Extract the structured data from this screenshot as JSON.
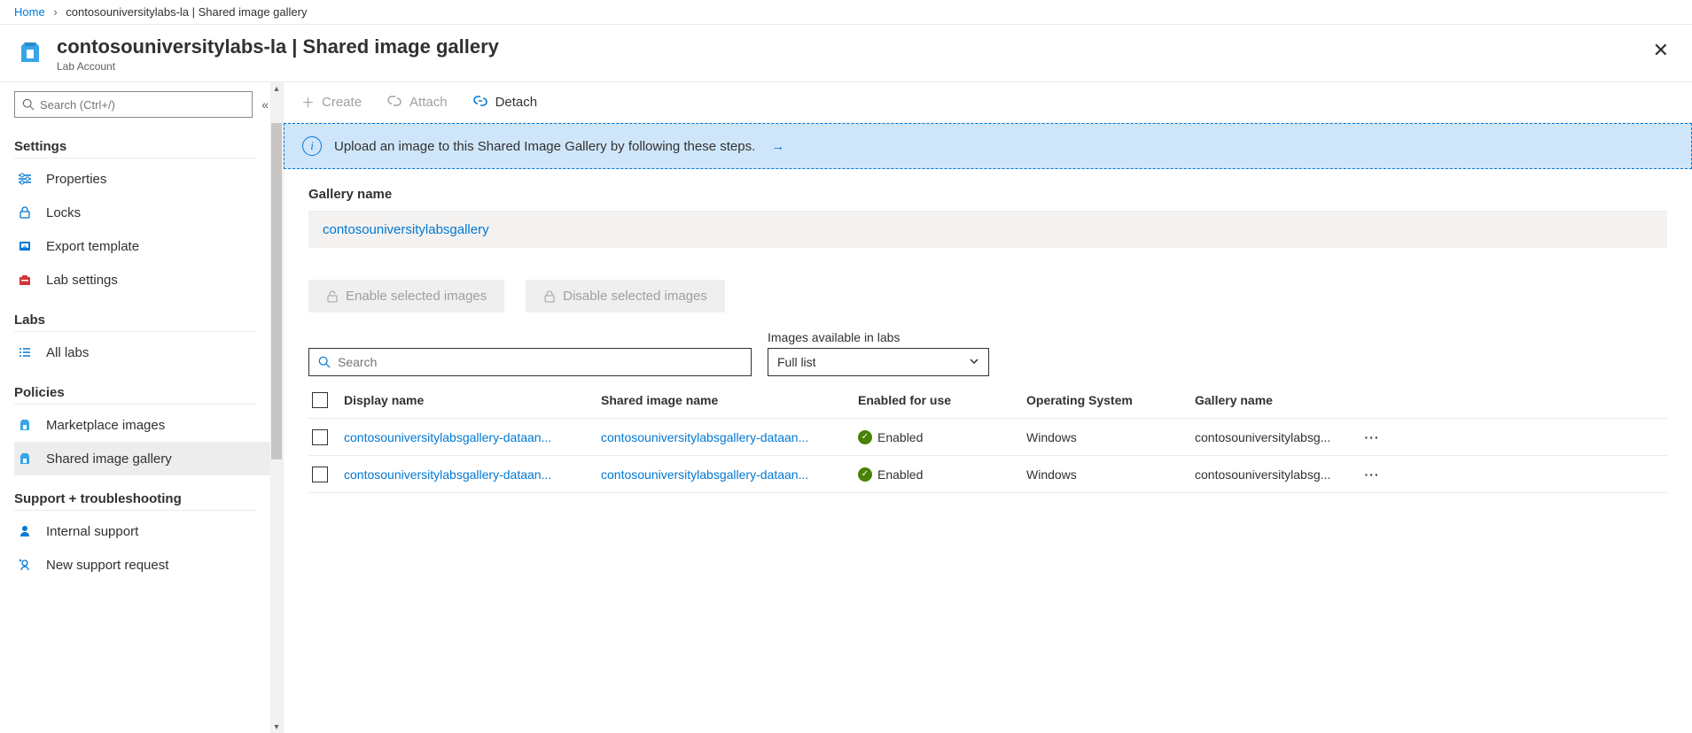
{
  "breadcrumb": {
    "home": "Home",
    "current": "contosouniversitylabs-la | Shared image gallery"
  },
  "header": {
    "title": "contosouniversitylabs-la | Shared image gallery",
    "subtitle": "Lab Account"
  },
  "search": {
    "placeholder": "Search (Ctrl+/)"
  },
  "sidebar": {
    "settings_title": "Settings",
    "labs_title": "Labs",
    "policies_title": "Policies",
    "support_title": "Support + troubleshooting",
    "items": {
      "properties": "Properties",
      "locks": "Locks",
      "export_template": "Export template",
      "lab_settings": "Lab settings",
      "all_labs": "All labs",
      "marketplace": "Marketplace images",
      "shared_gallery": "Shared image gallery",
      "internal_support": "Internal support",
      "new_request": "New support request"
    }
  },
  "toolbar": {
    "create": "Create",
    "attach": "Attach",
    "detach": "Detach"
  },
  "banner": {
    "text": "Upload an image to this Shared Image Gallery by following these steps."
  },
  "gallery": {
    "label": "Gallery name",
    "value": "contosouniversitylabsgallery"
  },
  "actions": {
    "enable": "Enable selected images",
    "disable": "Disable selected images"
  },
  "filters": {
    "search_placeholder": "Search",
    "available_label": "Images available in labs",
    "dropdown_value": "Full list"
  },
  "table": {
    "headers": {
      "display": "Display name",
      "shared": "Shared image name",
      "enabled": "Enabled for use",
      "os": "Operating System",
      "gallery": "Gallery name"
    },
    "rows": [
      {
        "display": "contosouniversitylabsgallery-dataan...",
        "shared": "contosouniversitylabsgallery-dataan...",
        "enabled": "Enabled",
        "os": "Windows",
        "gallery": "contosouniversitylabsg..."
      },
      {
        "display": "contosouniversitylabsgallery-dataan...",
        "shared": "contosouniversitylabsgallery-dataan...",
        "enabled": "Enabled",
        "os": "Windows",
        "gallery": "contosouniversitylabsg..."
      }
    ]
  }
}
